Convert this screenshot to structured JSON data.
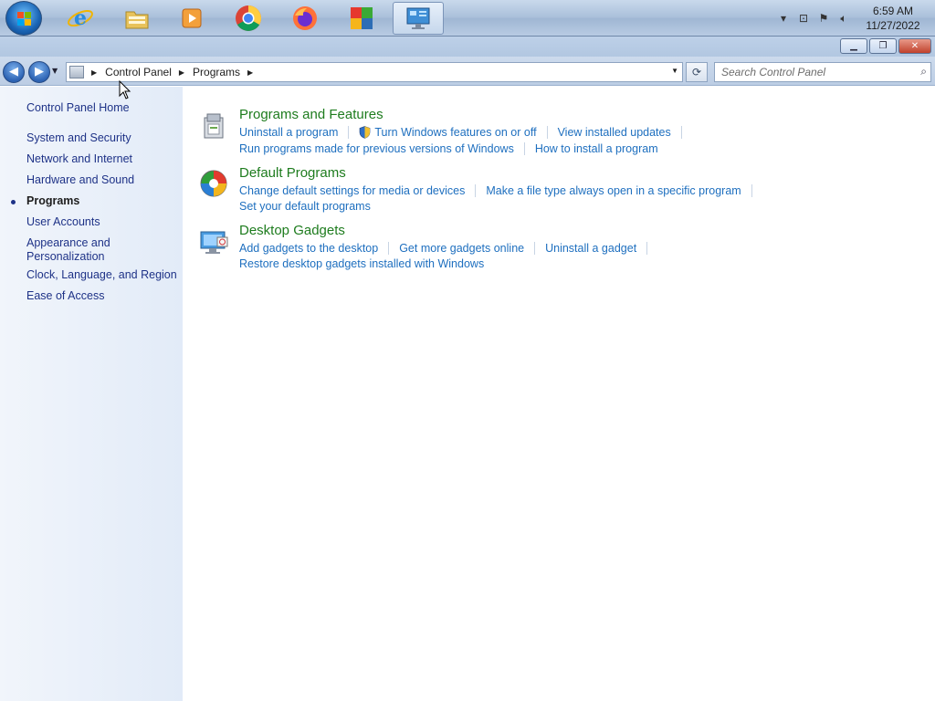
{
  "taskbar": {
    "apps": [
      {
        "name": "Internet Explorer",
        "icon": "ie-icon"
      },
      {
        "name": "Windows Explorer",
        "icon": "folder-icon"
      },
      {
        "name": "Windows Media Player",
        "icon": "media-player-icon"
      },
      {
        "name": "Google Chrome",
        "icon": "chrome-icon"
      },
      {
        "name": "Firefox",
        "icon": "firefox-icon"
      },
      {
        "name": "AVG",
        "icon": "avg-icon"
      },
      {
        "name": "Control Panel",
        "icon": "control-panel-icon",
        "active": true
      }
    ],
    "clock": {
      "time": "6:59 AM",
      "date": "11/27/2022"
    }
  },
  "address": {
    "crumbs": [
      "Control Panel",
      "Programs"
    ]
  },
  "search": {
    "placeholder": "Search Control Panel"
  },
  "sidebar": {
    "home": "Control Panel Home",
    "items": [
      {
        "label": "System and Security"
      },
      {
        "label": "Network and Internet"
      },
      {
        "label": "Hardware and Sound"
      },
      {
        "label": "Programs",
        "current": true
      },
      {
        "label": "User Accounts"
      },
      {
        "label": "Appearance and Personalization"
      },
      {
        "label": "Clock, Language, and Region"
      },
      {
        "label": "Ease of Access"
      }
    ]
  },
  "categories": [
    {
      "title": "Programs and Features",
      "links": [
        "Uninstall a program",
        "Turn Windows features on or off",
        "View installed updates",
        "Run programs made for previous versions of Windows",
        "How to install a program"
      ]
    },
    {
      "title": "Default Programs",
      "links": [
        "Change default settings for media or devices",
        "Make a file type always open in a specific program",
        "Set your default programs"
      ]
    },
    {
      "title": "Desktop Gadgets",
      "links": [
        "Add gadgets to the desktop",
        "Get more gadgets online",
        "Uninstall a gadget",
        "Restore desktop gadgets installed with Windows"
      ]
    }
  ],
  "colors": {
    "category_title": "#1e7c1e",
    "link": "#1e6fbf",
    "sidebar_link": "#1e3287"
  }
}
